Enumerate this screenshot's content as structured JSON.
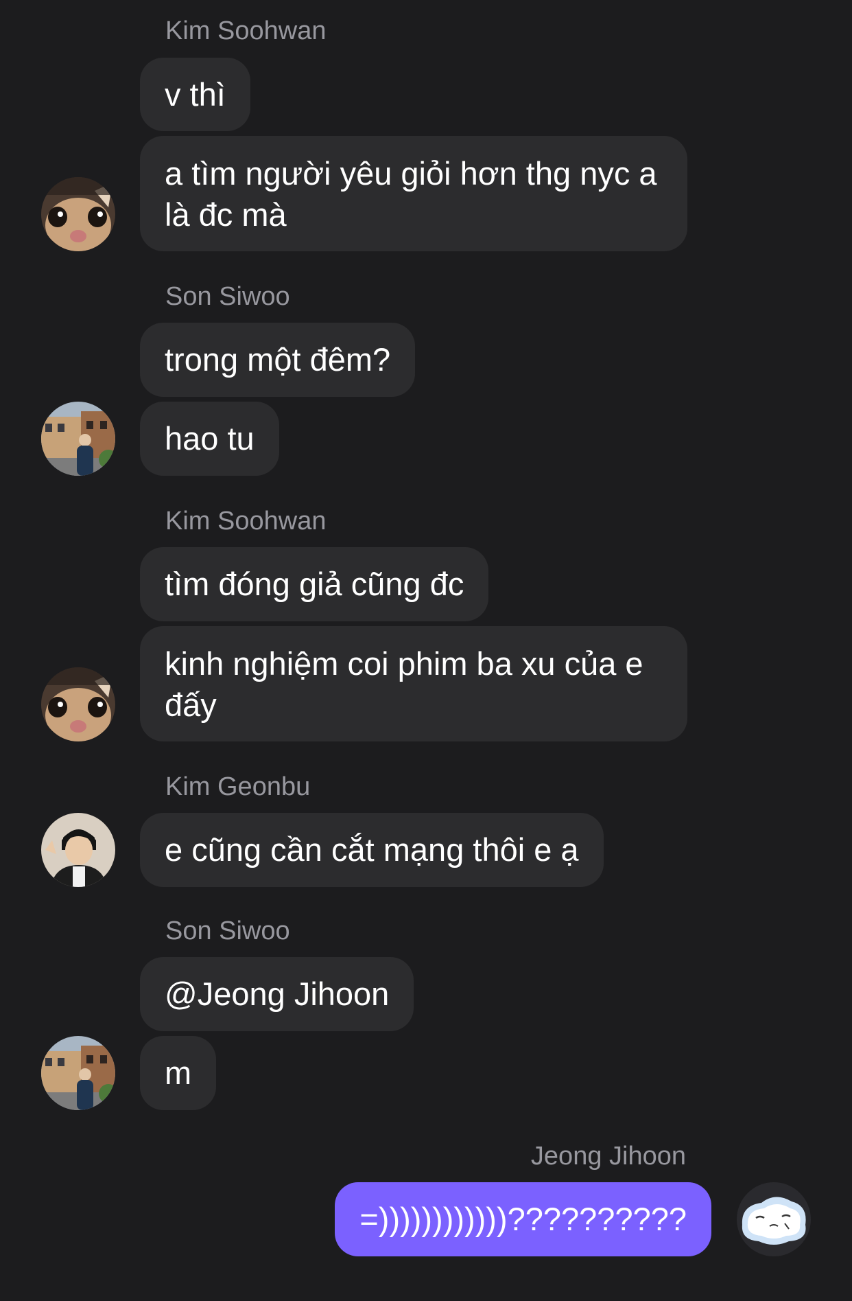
{
  "messages": {
    "group1": {
      "sender": "Kim Soohwan",
      "bubbles": [
        "v thì",
        "a tìm người yêu giỏi hơn thg nyc a là đc mà"
      ]
    },
    "group2": {
      "sender": "Son Siwoo",
      "bubbles": [
        "trong một đêm?",
        "hao tu"
      ]
    },
    "group3": {
      "sender": "Kim Soohwan",
      "bubbles": [
        "tìm đóng giả cũng đc",
        "kinh nghiệm coi phim ba xu của e đấy"
      ]
    },
    "group4": {
      "sender": "Kim Geonbu",
      "bubbles": [
        "e cũng cần cắt mạng thôi e ạ"
      ]
    },
    "group5": {
      "sender": "Son Siwoo",
      "bubbles": [
        "@Jeong Jihoon",
        "m"
      ]
    },
    "group6": {
      "sender": "Jeong Jihoon",
      "bubbles": [
        "=))))))))))))??????????"
      ]
    }
  },
  "colors": {
    "background": "#1c1c1e",
    "bubble": "#2c2c2e",
    "own_bubble": "#7b61ff",
    "sender_name": "#98989f"
  },
  "avatars": {
    "kim_soohwan": "cat-photo-avatar",
    "son_siwoo": "street-photo-avatar",
    "kim_geonbu": "person-photo-avatar",
    "jeong_jihoon": "cartoon-sticker-avatar"
  }
}
